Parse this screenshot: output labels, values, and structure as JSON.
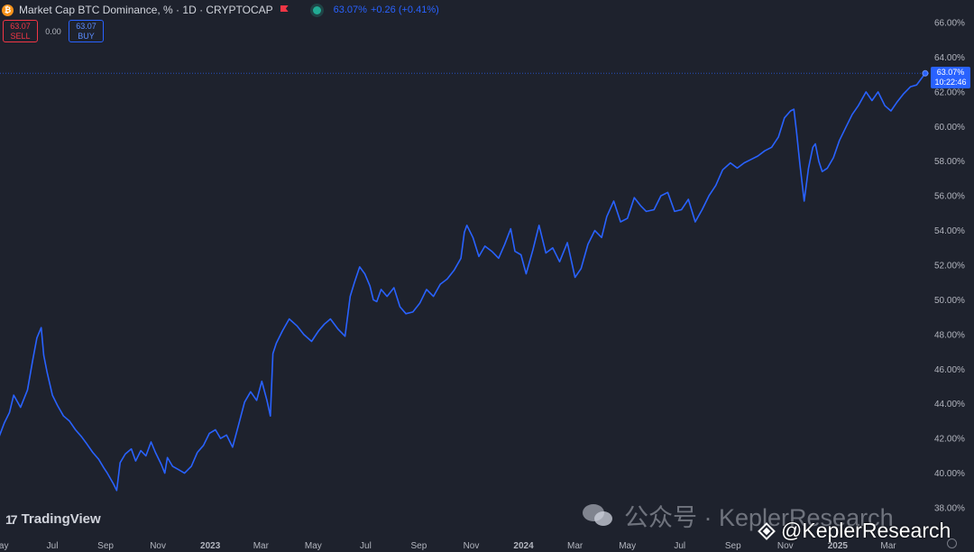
{
  "header": {
    "symbol_icon": "bitcoin-icon",
    "title": "Market Cap BTC Dominance, % · 1D · CRYPTOCAP",
    "flag_icon": "flag-icon",
    "status_icon": "market-open-dot-icon",
    "last": "63.07%",
    "change": "+0.26 (+0.41%)"
  },
  "trade": {
    "sell_price": "63.07",
    "sell_label": "SELL",
    "spread": "0.00",
    "buy_price": "63.07",
    "buy_label": "BUY"
  },
  "price_tag": {
    "price": "63.07%",
    "countdown": "10:22:46"
  },
  "branding": {
    "logo_text": "TradingView",
    "logo_mark": "17"
  },
  "watermark": {
    "wechat": "公众号 · KeplerResearch",
    "handle": "@KeplerResearch"
  },
  "colors": {
    "background": "#1e222d",
    "line": "#2962ff",
    "text": "#d1d4dc",
    "axis_text": "#b2b5be"
  },
  "chart_data": {
    "type": "line",
    "title": "Market Cap BTC Dominance, %",
    "ylim": [
      37.8,
      66.6
    ],
    "y_tick_labels": [
      "38.00%",
      "40.00%",
      "42.00%",
      "44.00%",
      "46.00%",
      "48.00%",
      "50.00%",
      "52.00%",
      "54.00%",
      "56.00%",
      "58.00%",
      "60.00%",
      "62.00%",
      "64.00%",
      "66.00%"
    ],
    "y_ticks": [
      38,
      40,
      42,
      44,
      46,
      48,
      50,
      52,
      54,
      56,
      58,
      60,
      62,
      64,
      66
    ],
    "x_tick_labels": [
      "May",
      "Jul",
      "Sep",
      "Nov",
      "2023",
      "Mar",
      "May",
      "Jul",
      "Sep",
      "Nov",
      "2024",
      "Mar",
      "May",
      "Jul",
      "Sep",
      "Nov",
      "2025",
      "Mar"
    ],
    "x_tick_dates": [
      "2022-05-01",
      "2022-07-01",
      "2022-09-01",
      "2022-11-01",
      "2023-01-01",
      "2023-03-01",
      "2023-05-01",
      "2023-07-01",
      "2023-09-01",
      "2023-11-01",
      "2024-01-01",
      "2024-03-01",
      "2024-05-01",
      "2024-07-01",
      "2024-09-01",
      "2024-11-01",
      "2025-01-01",
      "2025-03-01"
    ],
    "last_value": 63.07,
    "series": [
      {
        "x": [
          "2022-04-30",
          "2022-05-06",
          "2022-05-12",
          "2022-05-17",
          "2022-05-25",
          "2022-06-02",
          "2022-06-08",
          "2022-06-13",
          "2022-06-18",
          "2022-06-21",
          "2022-06-25",
          "2022-07-01",
          "2022-07-07",
          "2022-07-14",
          "2022-07-21",
          "2022-07-28",
          "2022-08-04",
          "2022-08-10",
          "2022-08-17",
          "2022-08-24",
          "2022-08-30",
          "2022-09-03",
          "2022-09-10",
          "2022-09-14",
          "2022-09-18",
          "2022-09-24",
          "2022-10-01",
          "2022-10-06",
          "2022-10-12",
          "2022-10-18",
          "2022-10-24",
          "2022-10-29",
          "2022-11-05",
          "2022-11-09",
          "2022-11-12",
          "2022-11-18",
          "2022-11-25",
          "2022-12-02",
          "2022-12-10",
          "2022-12-17",
          "2022-12-24",
          "2022-12-31",
          "2023-01-07",
          "2023-01-13",
          "2023-01-20",
          "2023-01-27",
          "2023-02-03",
          "2023-02-10",
          "2023-02-17",
          "2023-02-24",
          "2023-03-02",
          "2023-03-08",
          "2023-03-12",
          "2023-03-15",
          "2023-03-19",
          "2023-03-26",
          "2023-04-03",
          "2023-04-12",
          "2023-04-20",
          "2023-04-29",
          "2023-05-07",
          "2023-05-14",
          "2023-05-21",
          "2023-05-30",
          "2023-06-07",
          "2023-06-13",
          "2023-06-18",
          "2023-06-24",
          "2023-06-30",
          "2023-07-06",
          "2023-07-10",
          "2023-07-14",
          "2023-07-19",
          "2023-07-26",
          "2023-08-03",
          "2023-08-10",
          "2023-08-17",
          "2023-08-25",
          "2023-09-02",
          "2023-09-10",
          "2023-09-18",
          "2023-09-26",
          "2023-10-04",
          "2023-10-12",
          "2023-10-20",
          "2023-10-24",
          "2023-10-27",
          "2023-11-03",
          "2023-11-10",
          "2023-11-17",
          "2023-11-25",
          "2023-12-03",
          "2023-12-10",
          "2023-12-17",
          "2023-12-22",
          "2023-12-29",
          "2024-01-04",
          "2024-01-08",
          "2024-01-12",
          "2024-01-19",
          "2024-01-27",
          "2024-02-04",
          "2024-02-12",
          "2024-02-21",
          "2024-03-01",
          "2024-03-08",
          "2024-03-16",
          "2024-03-24",
          "2024-04-01",
          "2024-04-07",
          "2024-04-15",
          "2024-04-23",
          "2024-05-01",
          "2024-05-09",
          "2024-05-17",
          "2024-05-23",
          "2024-06-01",
          "2024-06-09",
          "2024-06-17",
          "2024-06-25",
          "2024-07-03",
          "2024-07-11",
          "2024-07-19",
          "2024-07-27",
          "2024-08-04",
          "2024-08-12",
          "2024-08-20",
          "2024-08-29",
          "2024-09-06",
          "2024-09-14",
          "2024-09-22",
          "2024-09-30",
          "2024-10-08",
          "2024-10-16",
          "2024-10-24",
          "2024-10-31",
          "2024-11-07",
          "2024-11-11",
          "2024-11-14",
          "2024-11-18",
          "2024-11-23",
          "2024-11-28",
          "2024-12-03",
          "2024-12-06",
          "2024-12-10",
          "2024-12-14",
          "2024-12-20",
          "2024-12-27",
          "2025-01-03",
          "2025-01-10",
          "2025-01-18",
          "2025-01-25",
          "2025-02-03",
          "2025-02-10",
          "2025-02-17",
          "2025-02-25",
          "2025-03-04",
          "2025-03-11",
          "2025-03-19",
          "2025-03-27",
          "2025-04-03",
          "2025-04-09",
          "2025-04-13"
        ],
        "y": [
          42.1,
          42.9,
          43.5,
          44.5,
          43.8,
          44.8,
          46.5,
          47.8,
          48.4,
          46.8,
          45.8,
          44.5,
          43.9,
          43.3,
          43.0,
          42.5,
          42.1,
          41.7,
          41.2,
          40.8,
          40.3,
          40.0,
          39.4,
          39.0,
          40.6,
          41.1,
          41.4,
          40.7,
          41.3,
          41.0,
          41.8,
          41.2,
          40.5,
          40.0,
          40.9,
          40.4,
          40.2,
          40.0,
          40.4,
          41.2,
          41.6,
          42.3,
          42.5,
          42.0,
          42.2,
          41.5,
          42.8,
          44.1,
          44.7,
          44.2,
          45.3,
          44.2,
          43.3,
          46.9,
          47.5,
          48.2,
          48.9,
          48.5,
          48.0,
          47.6,
          48.2,
          48.6,
          48.9,
          48.3,
          47.9,
          50.2,
          51.0,
          51.9,
          51.5,
          50.8,
          50.0,
          49.9,
          50.6,
          50.2,
          50.7,
          49.6,
          49.2,
          49.3,
          49.8,
          50.6,
          50.2,
          50.9,
          51.2,
          51.7,
          52.4,
          53.9,
          54.3,
          53.6,
          52.5,
          53.1,
          52.8,
          52.4,
          53.2,
          54.1,
          52.8,
          52.6,
          51.5,
          52.2,
          52.9,
          54.3,
          52.7,
          53.0,
          52.2,
          53.3,
          51.3,
          51.8,
          53.2,
          54.0,
          53.6,
          54.8,
          55.7,
          54.5,
          54.7,
          55.9,
          55.4,
          55.1,
          55.2,
          56.0,
          56.2,
          55.1,
          55.2,
          55.8,
          54.5,
          55.2,
          56.0,
          56.6,
          57.5,
          57.9,
          57.6,
          57.9,
          58.1,
          58.3,
          58.6,
          58.8,
          59.4,
          60.5,
          60.9,
          61.0,
          59.7,
          57.8,
          55.7,
          57.6,
          58.8,
          59.0,
          58.0,
          57.4,
          57.6,
          58.2,
          59.2,
          59.9,
          60.7,
          61.2,
          62.0,
          61.5,
          62.0,
          61.2,
          60.9,
          61.4,
          61.9,
          62.3,
          62.4,
          62.8,
          63.07
        ]
      }
    ]
  }
}
